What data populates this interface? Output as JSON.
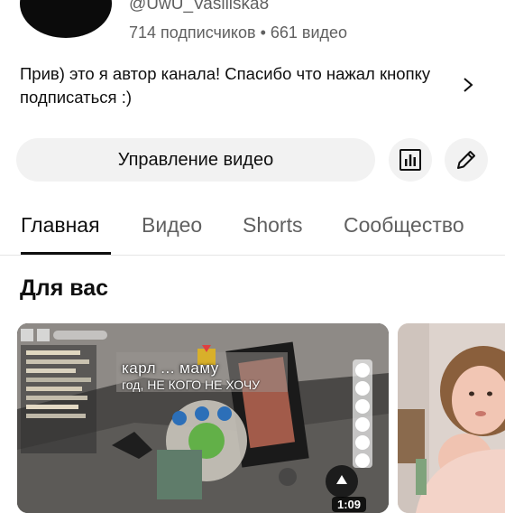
{
  "channel": {
    "handle": "@UwU_Vasiliska8",
    "stats": "714 подписчиков • 661 видео",
    "description": "Прив) это я автор канала! Спасибо что нажал кнопку подписаться :)"
  },
  "actions": {
    "manage_label": "Управление видео",
    "analytics_icon": "bar-chart-icon",
    "edit_icon": "pencil-icon"
  },
  "tabs": [
    {
      "label": "Главная",
      "active": true
    },
    {
      "label": "Видео",
      "active": false
    },
    {
      "label": "Shorts",
      "active": false
    },
    {
      "label": "Сообщество",
      "active": false
    }
  ],
  "section": {
    "title": "Для вас"
  },
  "videos": [
    {
      "overlay_title": "карл ... маму",
      "overlay_subtitle": "год, НЕ КОГО НЕ ХОЧУ",
      "duration": "1:09"
    },
    {
      "overlay_title": "",
      "overlay_subtitle": "",
      "duration": ""
    }
  ],
  "colors": {
    "text_primary": "#0f0f0f",
    "text_secondary": "#606060",
    "button_bg": "#f2f2f2"
  }
}
